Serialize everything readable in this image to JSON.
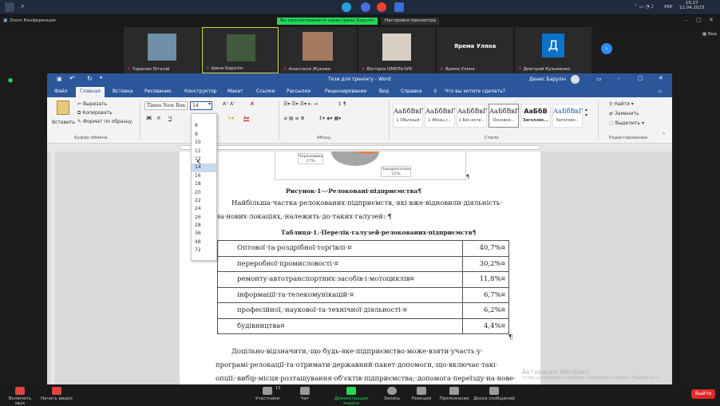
{
  "taskbar": {
    "time": "10:27",
    "date": "12.04.2023",
    "lang": "УКР"
  },
  "zoom": {
    "title": "Zoom Конференция",
    "sharing_banner": "Вы просматриваете экран Ірина Барулін",
    "view_options": "Настройки просмотра",
    "view_btn": "Вид"
  },
  "participants": [
    {
      "name": "Тарасюк Віталій"
    },
    {
      "name": "Ірина Барулін"
    },
    {
      "name": "Анастасія Жукова"
    },
    {
      "name": "Вікторія ОМЕЛЬЧУК"
    },
    {
      "name": "Ярема Уляна",
      "display": "Ярема Уляна"
    },
    {
      "name": "Дмитрий Кузьменко",
      "avatar": "Д"
    }
  ],
  "word": {
    "title": "Тези для тренінгу - Word",
    "user": "Денис Барулін",
    "tabs": [
      "Файл",
      "Главная",
      "Вставка",
      "Рисование",
      "Конструктор",
      "Макет",
      "Ссылки",
      "Рассылки",
      "Рецензирование",
      "Вид",
      "Справка"
    ],
    "tell_me": "Что вы хотите сделать?",
    "clipboard": {
      "paste": "Вставить",
      "cut": "Вырезать",
      "copy": "Копировать",
      "format": "Формат по образцу",
      "group": "Буфер обмена"
    },
    "font": {
      "name": "Times New Ron",
      "size": "14"
    },
    "groups": {
      "paragraph": "Абзац",
      "styles": "Стили",
      "editing": "Редактирование"
    },
    "styles": [
      {
        "sample": "АаБбВвГ",
        "label": "1 Обычный"
      },
      {
        "sample": "АаБбВвГ",
        "label": "1 Абзац с..."
      },
      {
        "sample": "АаБбВвГ",
        "label": "1 Без инте..."
      },
      {
        "sample": "АаБбВвГ",
        "label": "Основно..."
      },
      {
        "sample": "АаБбВ",
        "label": "Заголово..."
      },
      {
        "sample": "АаБбВвГ",
        "label": "Заголово..."
      }
    ],
    "editing": {
      "find": "Найти",
      "replace": "Заменить",
      "select": "Выделить"
    },
    "font_sizes": [
      "8",
      "9",
      "10",
      "11",
      "12",
      "14",
      "16",
      "18",
      "20",
      "22",
      "24",
      "26",
      "28",
      "36",
      "48",
      "72"
    ],
    "selected_size": "14"
  },
  "doc": {
    "chart_label_1": "Черкащина\n17%",
    "chart_label_2": "Закарпатська\n22%",
    "figure_caption": "Рисунок·1·–·Релоковані·підприємства¶",
    "para1a": "Найбільша·частка·релокованих·підприємств,·які·вже·відновили·діяльність·",
    "para1b": "на·нових·локаціях,·належить·до·таких·галузей:·¶",
    "table_caption": "Таблиця·1.·Перелік·галузей·релокованих·підприємств¶",
    "table": [
      [
        "Оптової·та·роздрібної·торгівлі·¤",
        "40,7%¤"
      ],
      [
        "переробної·промисловості·¤",
        "30,2%¤"
      ],
      [
        "ремонту·автотранспортних·засобів·і·мотоциклів¤",
        "11,8%¤"
      ],
      [
        "інформації·та·телекомунікацій·¤",
        "6,7%¤"
      ],
      [
        "професійної,·наукової·та·технічної·діяльності·¤",
        "6,2%¤"
      ],
      [
        "будівництва¤",
        "4,4%¤"
      ]
    ],
    "pilcrow": "¶",
    "para2a": "Доцільно·відзначити,·що·будь-яке·підприємство·може·взяти·участь·у·",
    "para2b": "програмі·релокації·та·отримати·державний·пакет·допомоги,·що·включає·такі·",
    "para2c": "опції:·вибір·місця·розташування·об'єктів·підприємства;·допомога·переїзду·на·нове·"
  },
  "watermark": {
    "line1": "Активация Windows",
    "line2": "Чтобы активировать Windows, перейдите в раздел \"Параметры\"."
  },
  "bottom": {
    "mic": "Включить звук",
    "video": "Начать видео",
    "participants": "Участники",
    "participants_count": "13",
    "chat": "Чат",
    "share": "Демонстрация экрана",
    "record": "Запись",
    "reactions": "Реакции",
    "apps": "Приложения",
    "whiteboard": "Доска сообщений",
    "leave": "Выйти"
  },
  "colors": {
    "word_blue": "#2b579a",
    "leave_red": "#e02828",
    "share_green": "#23d959"
  }
}
